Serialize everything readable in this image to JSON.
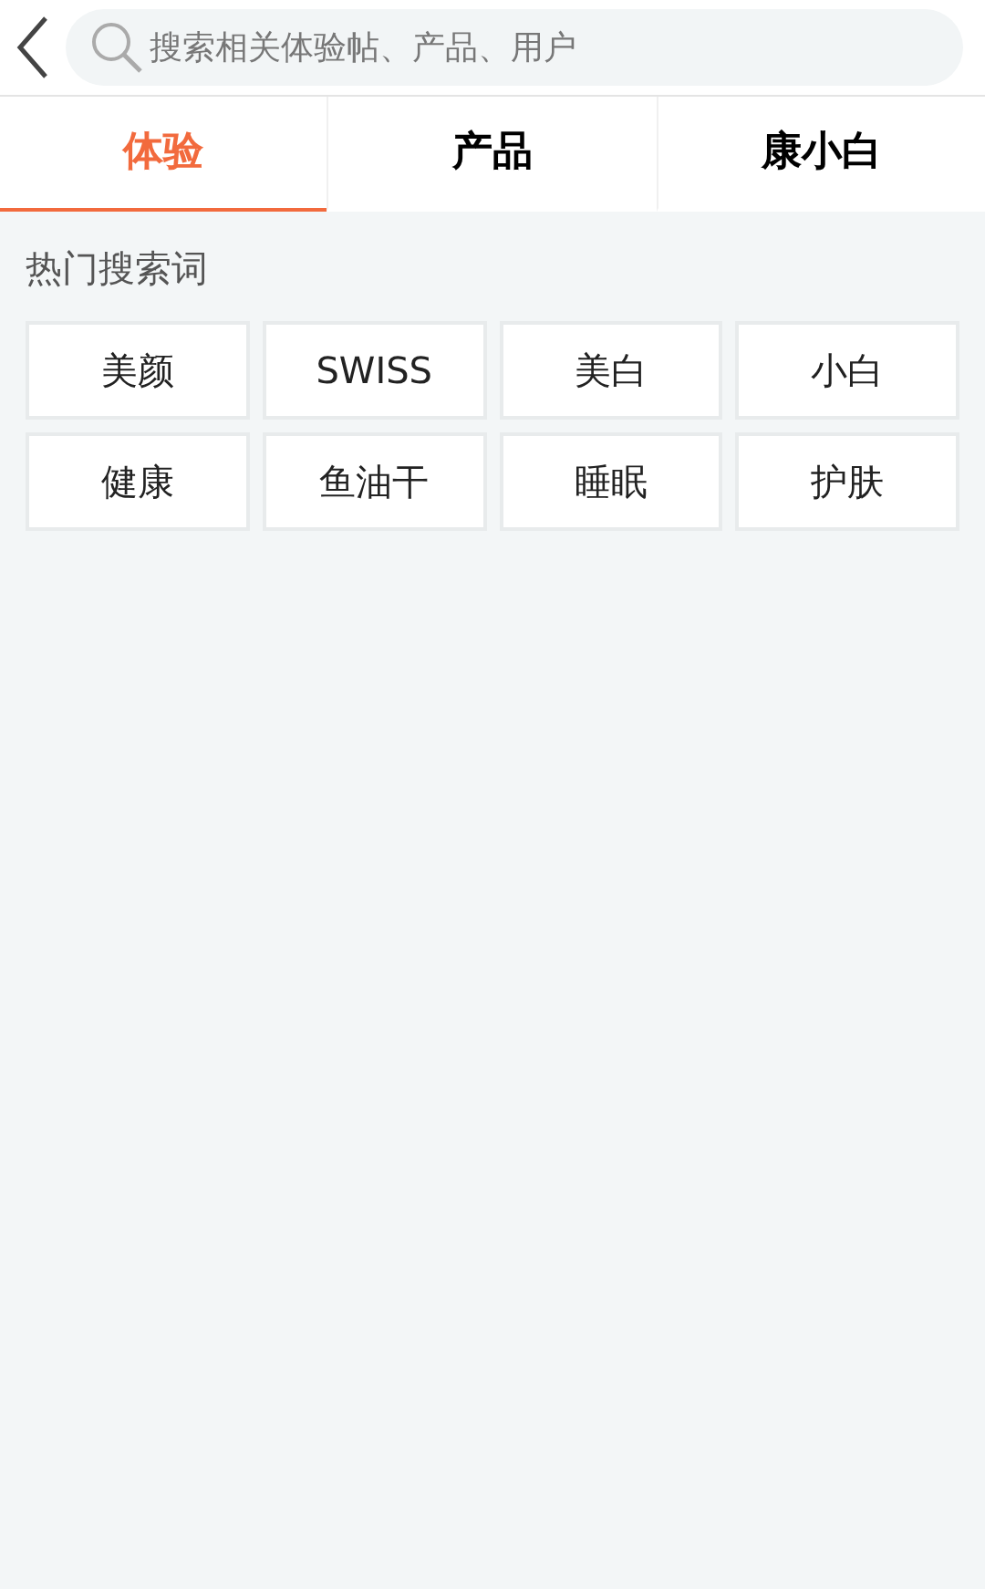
{
  "search": {
    "placeholder": "搜索相关体验帖、产品、用户"
  },
  "tabs": [
    {
      "label": "体验",
      "selected": true
    },
    {
      "label": "产品",
      "selected": false
    },
    {
      "label": "康小白",
      "selected": false
    }
  ],
  "hot_searches": {
    "title": "热门搜索词",
    "keywords": [
      "美颜",
      "SWISS",
      "美白",
      "小白",
      "健康",
      "鱼油干",
      "睡眠",
      "护肤"
    ]
  }
}
